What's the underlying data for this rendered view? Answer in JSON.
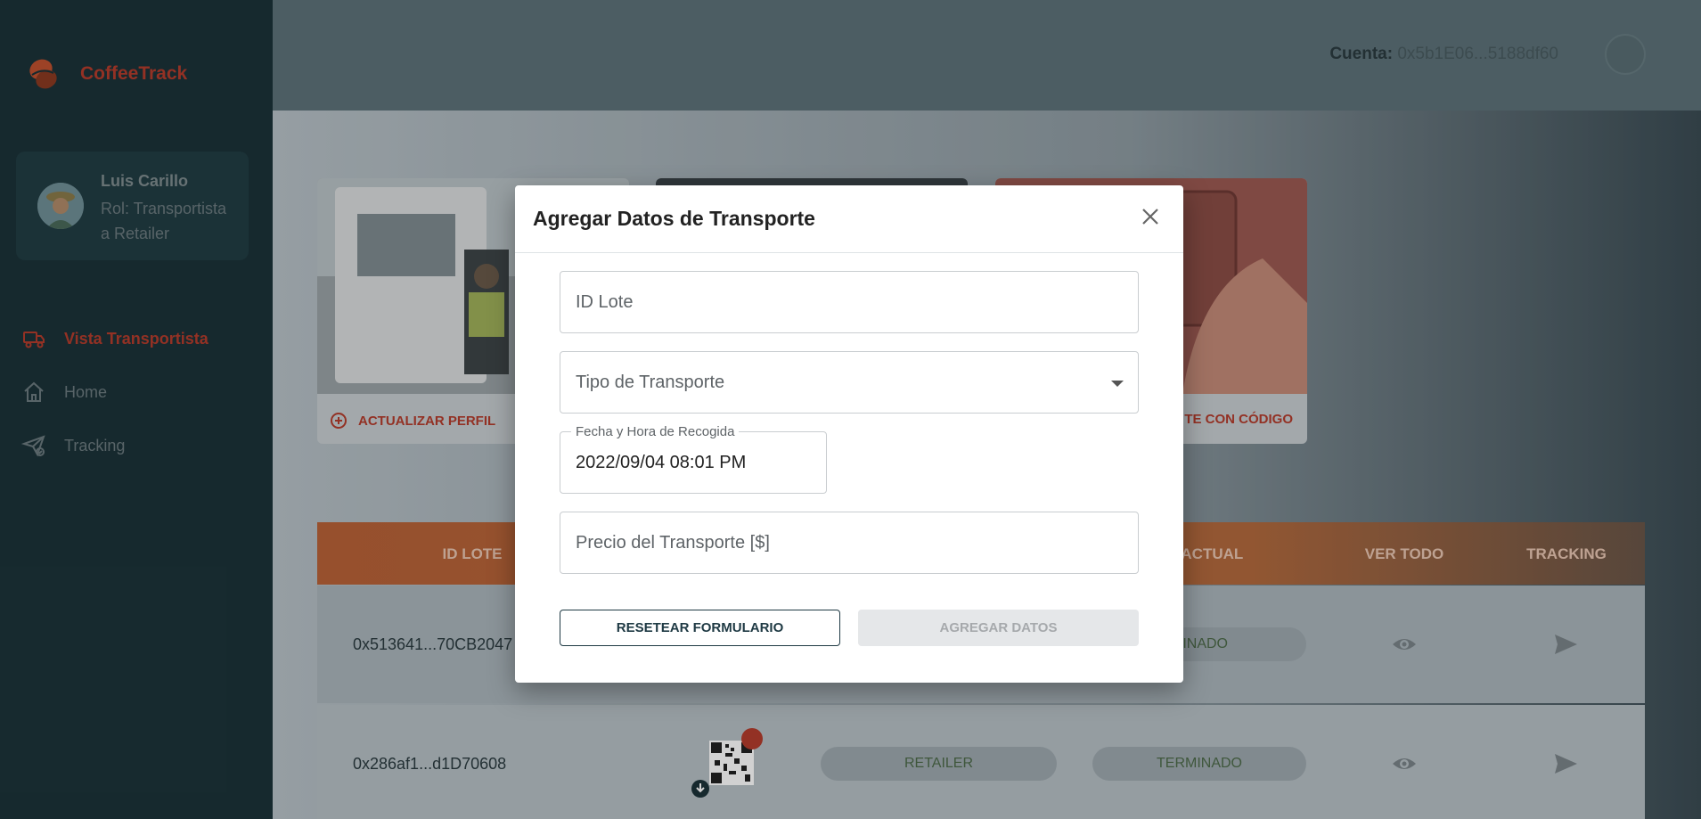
{
  "sidebar": {
    "brand": "CoffeeTrack",
    "user": {
      "name": "Luis Carillo",
      "role": "Rol: Transportista a Retailer"
    },
    "nav": [
      {
        "label": "Vista Transportista",
        "icon": "truck-icon",
        "active": true
      },
      {
        "label": "Home",
        "icon": "home-icon"
      },
      {
        "label": "Tracking",
        "icon": "send-check-icon"
      }
    ]
  },
  "header": {
    "account_label": "Cuenta:",
    "account_value": "0x5b1E06...5188df60"
  },
  "cards": [
    {
      "action": "ACTUALIZAR PERFIL"
    },
    {
      "action": ""
    },
    {
      "action": "TE CON CÓDIGO"
    }
  ],
  "table": {
    "headers": [
      "ID LOTE",
      "SO ACTUAL",
      "VER TODO",
      "TRACKING"
    ],
    "rows": [
      {
        "id": "0x513641...70CB2047",
        "stage": "",
        "status": "MINADO"
      },
      {
        "id": "0x286af1...d1D70608",
        "stage": "RETAILER",
        "status": "TERMINADO"
      }
    ]
  },
  "modal": {
    "title": "Agregar Datos de Transporte",
    "fields": {
      "lote": {
        "placeholder": "ID Lote"
      },
      "tipo": {
        "placeholder": "Tipo de Transporte"
      },
      "fecha": {
        "label": "Fecha y Hora de Recogida",
        "value": "2022/09/04 08:01 PM"
      },
      "precio": {
        "placeholder": "Precio del Transporte [$]"
      }
    },
    "buttons": {
      "reset": "RESETEAR FORMULARIO",
      "submit": "AGREGAR DATOS"
    }
  },
  "colors": {
    "brand_red": "#b43c2c",
    "sidebar_bg": "#1c3339",
    "table_head": "#b96238"
  }
}
